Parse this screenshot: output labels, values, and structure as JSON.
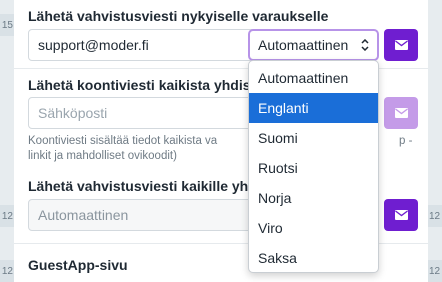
{
  "left_edge_chips": [
    "15",
    "12",
    "12"
  ],
  "right_edge_chips": [
    "12",
    "12"
  ],
  "section1": {
    "label": "Lähetä vahvistusviesti nykyiselle varaukselle",
    "email_value": "support@moder.fi",
    "language_selected": "Automaattinen"
  },
  "section2": {
    "label": "Lähetä koontiviesti kaikista yhdis",
    "email_placeholder": "Sähköposti",
    "hint_line1": "Koontiviesti sisältää tiedot kaikista va",
    "hint_line1_tail": "p -",
    "hint_line2": "linkit ja mahdolliset ovikoodit)"
  },
  "section3": {
    "label": "Lähetä vahvistusviesti kaikille yho",
    "language_value": "Automaattinen"
  },
  "section4": {
    "label": "GuestApp-sivu"
  },
  "dropdown": {
    "options": [
      "Automaattinen",
      "Englanti",
      "Suomi",
      "Ruotsi",
      "Norja",
      "Viro",
      "Saksa"
    ],
    "highlighted": "Englanti"
  },
  "colors": {
    "accent": "#6f1ed0",
    "accent_disabled": "#c49be8",
    "highlight": "#1a6ed8"
  },
  "icons": {
    "send": "envelope-icon"
  }
}
